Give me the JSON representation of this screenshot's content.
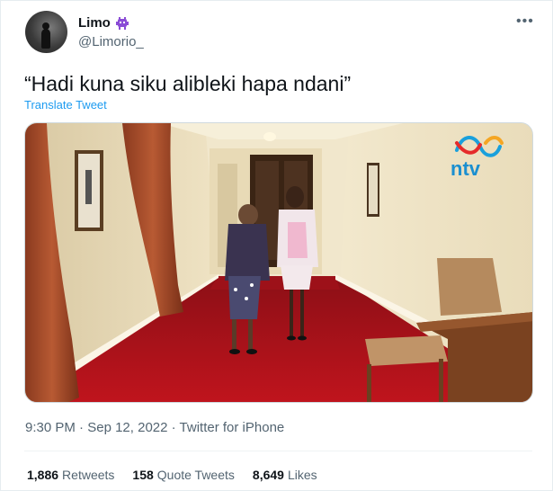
{
  "user": {
    "display_name": "Limo",
    "handle": "@Limorio_",
    "emoji_icon": "alien-monster-icon"
  },
  "tweet": {
    "text": "“Hadi kuna siku alibleki hapa ndani”",
    "translate_label": "Translate Tweet"
  },
  "media": {
    "watermark": "ntv"
  },
  "meta": {
    "time": "9:30 PM",
    "sep1": "·",
    "date": "Sep 12, 2022",
    "sep2": "·",
    "source": "Twitter for iPhone"
  },
  "stats": {
    "retweets_count": "1,886",
    "retweets_label": "Retweets",
    "quotes_count": "158",
    "quotes_label": "Quote Tweets",
    "likes_count": "8,649",
    "likes_label": "Likes"
  },
  "colors": {
    "link": "#1d9bf0",
    "secondary_text": "#536471",
    "primary_text": "#0f1419",
    "carpet": "#b3121b"
  }
}
